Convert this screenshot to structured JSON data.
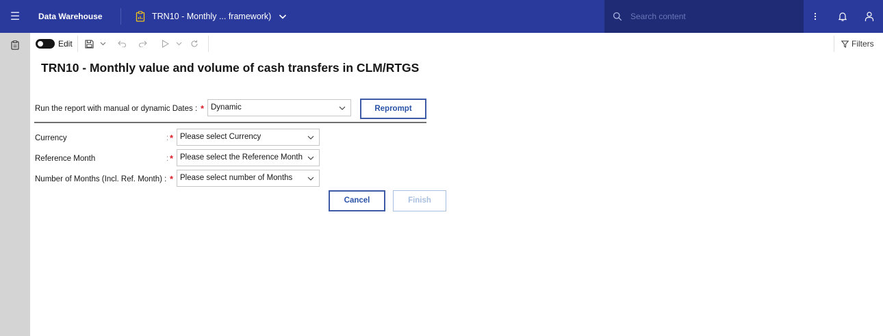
{
  "header": {
    "app_name": "Data Warehouse",
    "report_tab_label": "TRN10 - Monthly ... framework)",
    "search_placeholder": "Search content",
    "bg_color": "#2a3a9c"
  },
  "toolbar": {
    "edit_label": "Edit",
    "filters_label": "Filters"
  },
  "report": {
    "title": "TRN10 - Monthly value and volume of cash transfers in CLM/RTGS"
  },
  "prompts": {
    "date_mode": {
      "label": "Run the report with manual or dynamic Dates :",
      "value": "Dynamic"
    },
    "reprompt_label": "Reprompt",
    "currency": {
      "label": "Currency",
      "value": "Please select Currency"
    },
    "reference_month": {
      "label": "Reference Month",
      "value": "Please select the Reference Month"
    },
    "number_of_months": {
      "label": "Number of Months (Incl. Ref. Month) :",
      "value": "Please select number of Months"
    },
    "colon": ":",
    "required_mark": "*",
    "cancel_label": "Cancel",
    "finish_label": "Finish"
  },
  "icons": {
    "menu": "hamburger-menu-icon",
    "report": "report-document-icon",
    "search": "search-icon",
    "more": "overflow-menu-icon",
    "notification": "notification-bell-icon",
    "user": "user-icon",
    "save": "save-icon",
    "undo": "undo-icon",
    "redo": "redo-icon",
    "run": "run-play-icon",
    "refresh": "refresh-icon",
    "filter": "filter-icon"
  }
}
